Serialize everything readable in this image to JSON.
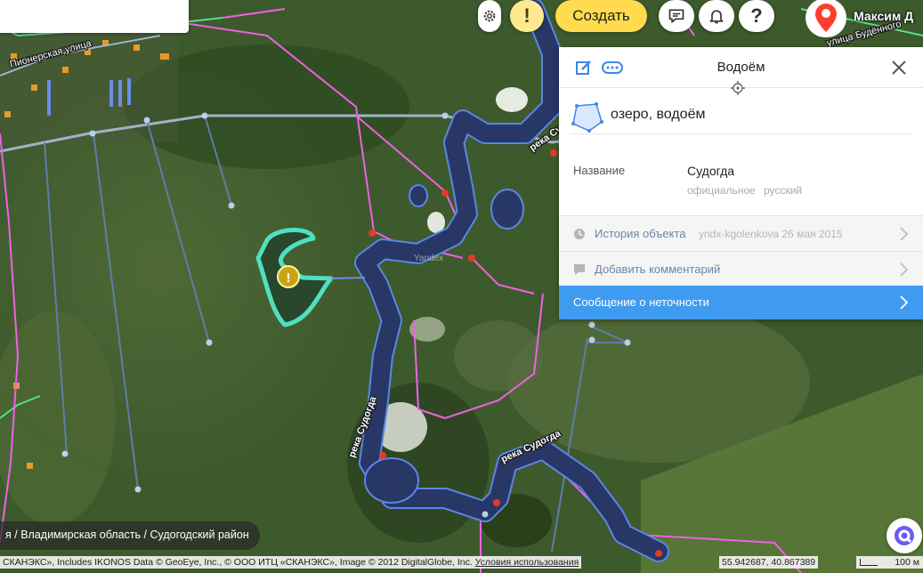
{
  "map": {
    "labels": {
      "street_pioneer": "Пионерская улица",
      "street_budennogo": "улица Будённого",
      "river_label_1": "река Су",
      "river_label_2": "река Судогда",
      "river_label_3": "река Судогда",
      "watermark": "Yandex"
    },
    "colors": {
      "satellite_base": "#34512a",
      "river_fill": "#2b3b6e",
      "river_outline": "#5b86e6",
      "boundary_pink": "#f060e8",
      "road_gray": "#b8c8d8",
      "selection": "#4fe0c0",
      "node_red": "#e33a2a"
    }
  },
  "toolbar": {
    "gear_icon": "gear-icon",
    "warning_label": "!",
    "create_label": "Создать",
    "message_icon": "chat-icon",
    "bell_icon": "bell-icon",
    "help_label": "?",
    "user_name": "Максим Д"
  },
  "panel": {
    "title": "Водоём",
    "type_label": "озеро, водоём",
    "name_key": "Название",
    "name_value": "Судогда",
    "name_meta_1": "официальное",
    "name_meta_2": "русский",
    "history_label": "История объекта",
    "history_meta": "yndx-kgolenkova 26 мая 2015",
    "comment_label": "Добавить комментарий",
    "report_label": "Сообщение о неточности"
  },
  "breadcrumb": "я / Владимирская область / Судогодский район",
  "footer": {
    "copyright": "СКАНЭКС», Includes IKONOS Data © GeoEye, Inc., © ООО ИТЦ «СКАНЭКС», Image © 2012 DigitalGlobe, Inc.",
    "terms_link": "Условия использования",
    "coords": "55.942687, 40.867389",
    "scale": "100 м"
  }
}
